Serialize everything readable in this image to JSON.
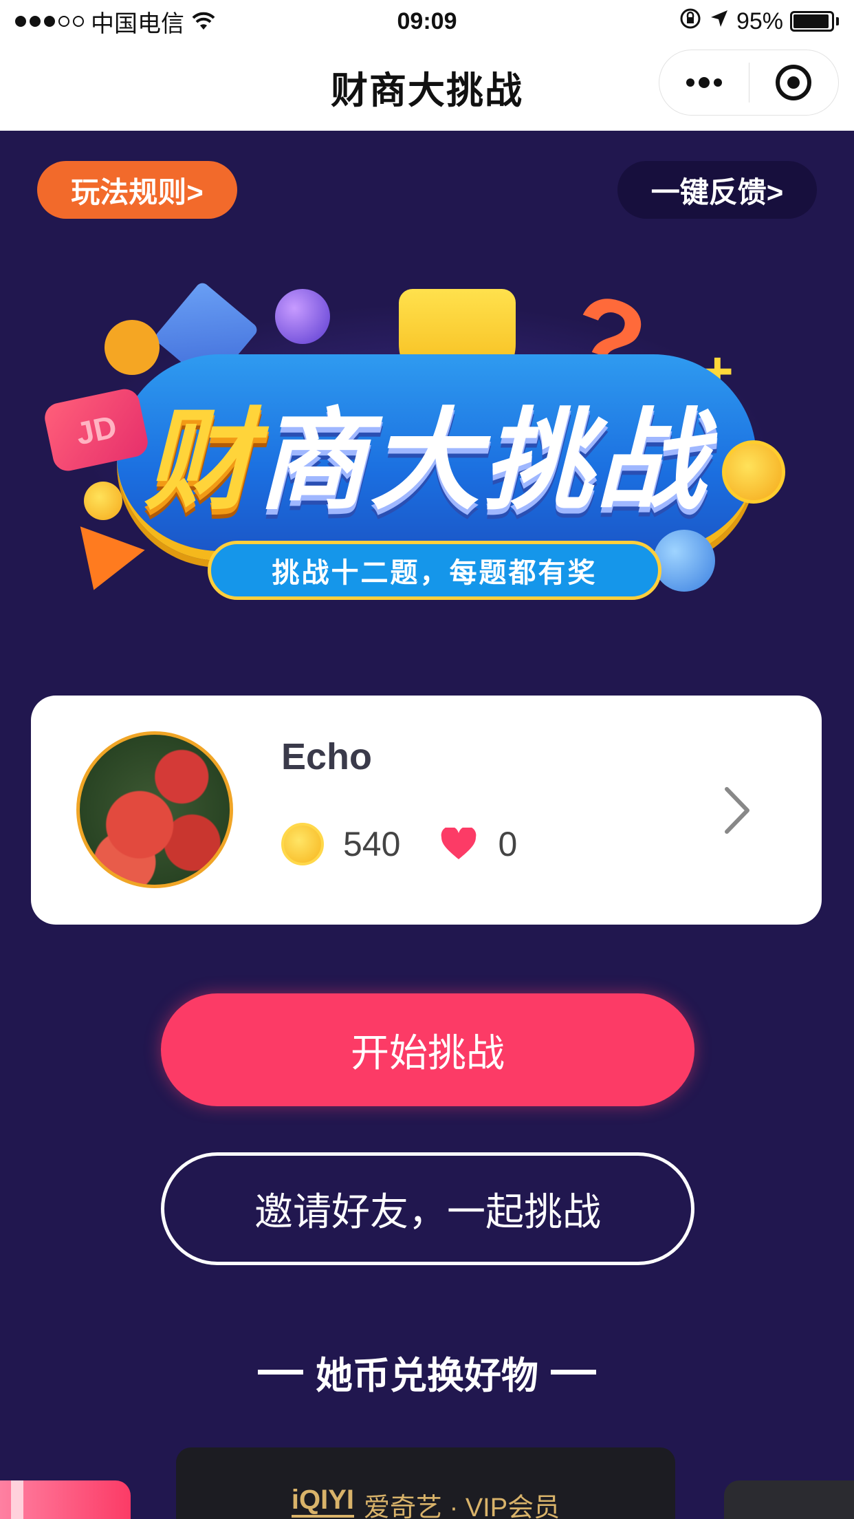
{
  "status_bar": {
    "carrier": "中国电信",
    "time": "09:09",
    "battery": "95%",
    "battery_level": 0.95,
    "signal_filled": 3,
    "signal_total": 5
  },
  "nav": {
    "title": "财商大挑战"
  },
  "top_buttons": {
    "rules": "玩法规则>",
    "feedback": "一键反馈>"
  },
  "banner": {
    "title_gold": "财",
    "title_rest": "商大挑战",
    "subtitle": "挑战十二题，每题都有奖",
    "jd_badge": "JD"
  },
  "profile": {
    "name": "Echo",
    "coins": "540",
    "hearts": "0"
  },
  "buttons": {
    "start": "开始挑战",
    "invite": "邀请好友，一起挑战"
  },
  "section": {
    "title": "她币兑换好物"
  },
  "rewards": {
    "center_logo": "iQIYI",
    "center_label": "爱奇艺 · VIP会员"
  },
  "colors": {
    "background": "#21174f",
    "accent_pink": "#fc3b66",
    "rules_orange": "#f26a2b",
    "coin_gold": "#f7b51d"
  },
  "icons": {
    "nav_more": "more-dots-icon",
    "nav_close": "target-circle-icon",
    "coin": "coin-icon",
    "heart": "heart-icon",
    "chevron": "chevron-right-icon"
  }
}
